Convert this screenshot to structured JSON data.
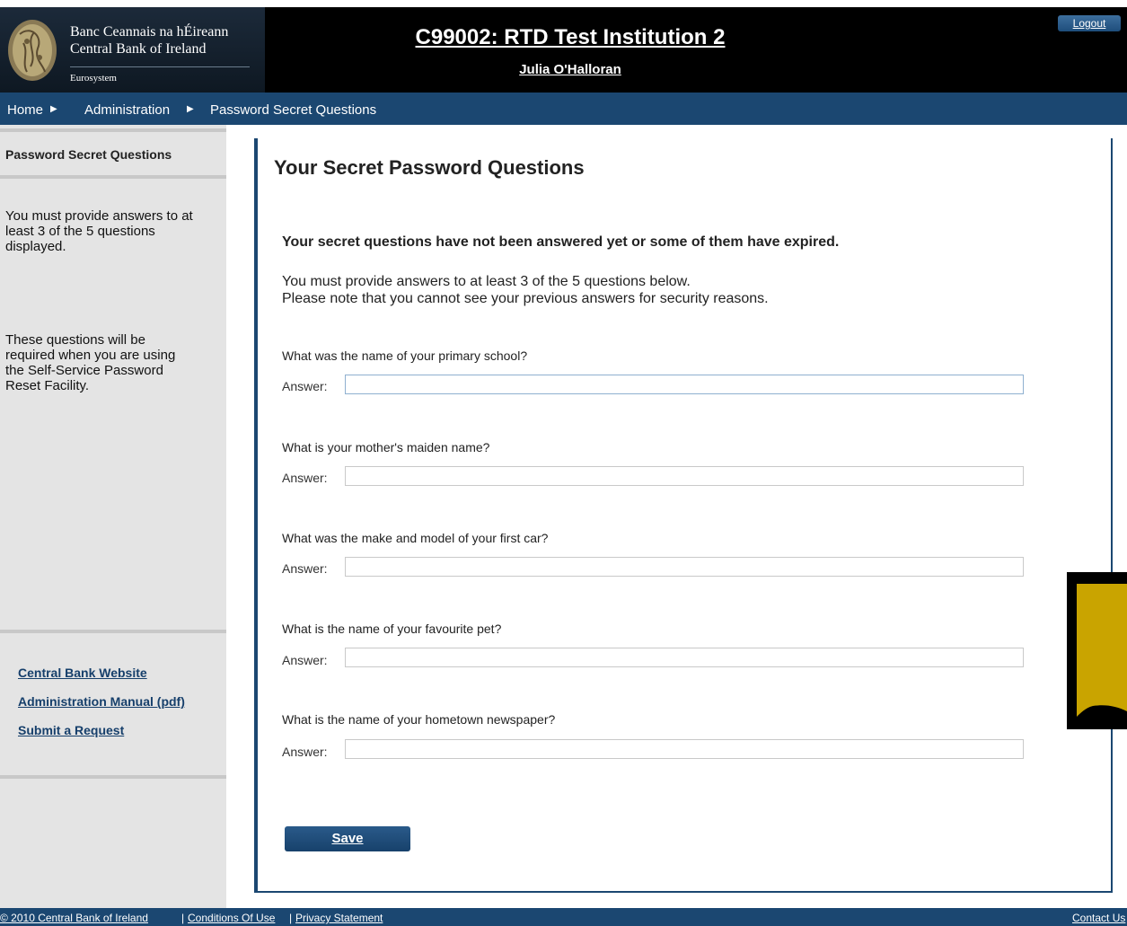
{
  "header": {
    "bank_name_line1": "Banc Ceannais na hÉireann",
    "bank_name_line2": "Central Bank of Ireland",
    "eurosystem": "Eurosystem",
    "institution_title": "C99002: RTD Test Institution 2",
    "user_name": "Julia O'Halloran",
    "logout_label": "Logout"
  },
  "breadcrumb": {
    "items": [
      "Home",
      "Administration",
      "Password Secret Questions"
    ]
  },
  "sidebar": {
    "heading": "Password Secret Questions",
    "text1_lines": [
      "You must provide answers to at",
      "least 3 of the 5 questions",
      "displayed."
    ],
    "text2_lines": [
      "These questions will be",
      "required when you are using",
      "the Self-Service Password",
      "Reset Facility."
    ],
    "links": [
      "Central Bank Website",
      "Administration Manual (pdf)",
      "Submit a Request"
    ]
  },
  "main": {
    "title": "Your Secret Password Questions",
    "warning": "Your secret questions have not been answered yet or some of them have expired.",
    "info_line1": "You must provide answers to at least 3 of the 5 questions below.",
    "info_line2": "Please note that you cannot see your previous answers for security reasons.",
    "answer_label": "Answer:",
    "questions": [
      {
        "label": "What was the name of your primary school?",
        "value": ""
      },
      {
        "label": "What is your mother's maiden name?",
        "value": ""
      },
      {
        "label": "What was the make and model of your first car?",
        "value": ""
      },
      {
        "label": "What is the name of your favourite pet?",
        "value": ""
      },
      {
        "label": "What is the name of your hometown newspaper?",
        "value": ""
      }
    ],
    "save_label": "Save"
  },
  "footer": {
    "copyright": "© 2010 Central Bank of Ireland",
    "separator": "|",
    "conditions": "Conditions Of Use",
    "privacy": "Privacy Statement",
    "contact": "Contact Us"
  },
  "colors": {
    "nav_blue": "#1b4771",
    "sidebar_gray": "#e4e4e4",
    "note_yellow": "#c9a400"
  }
}
